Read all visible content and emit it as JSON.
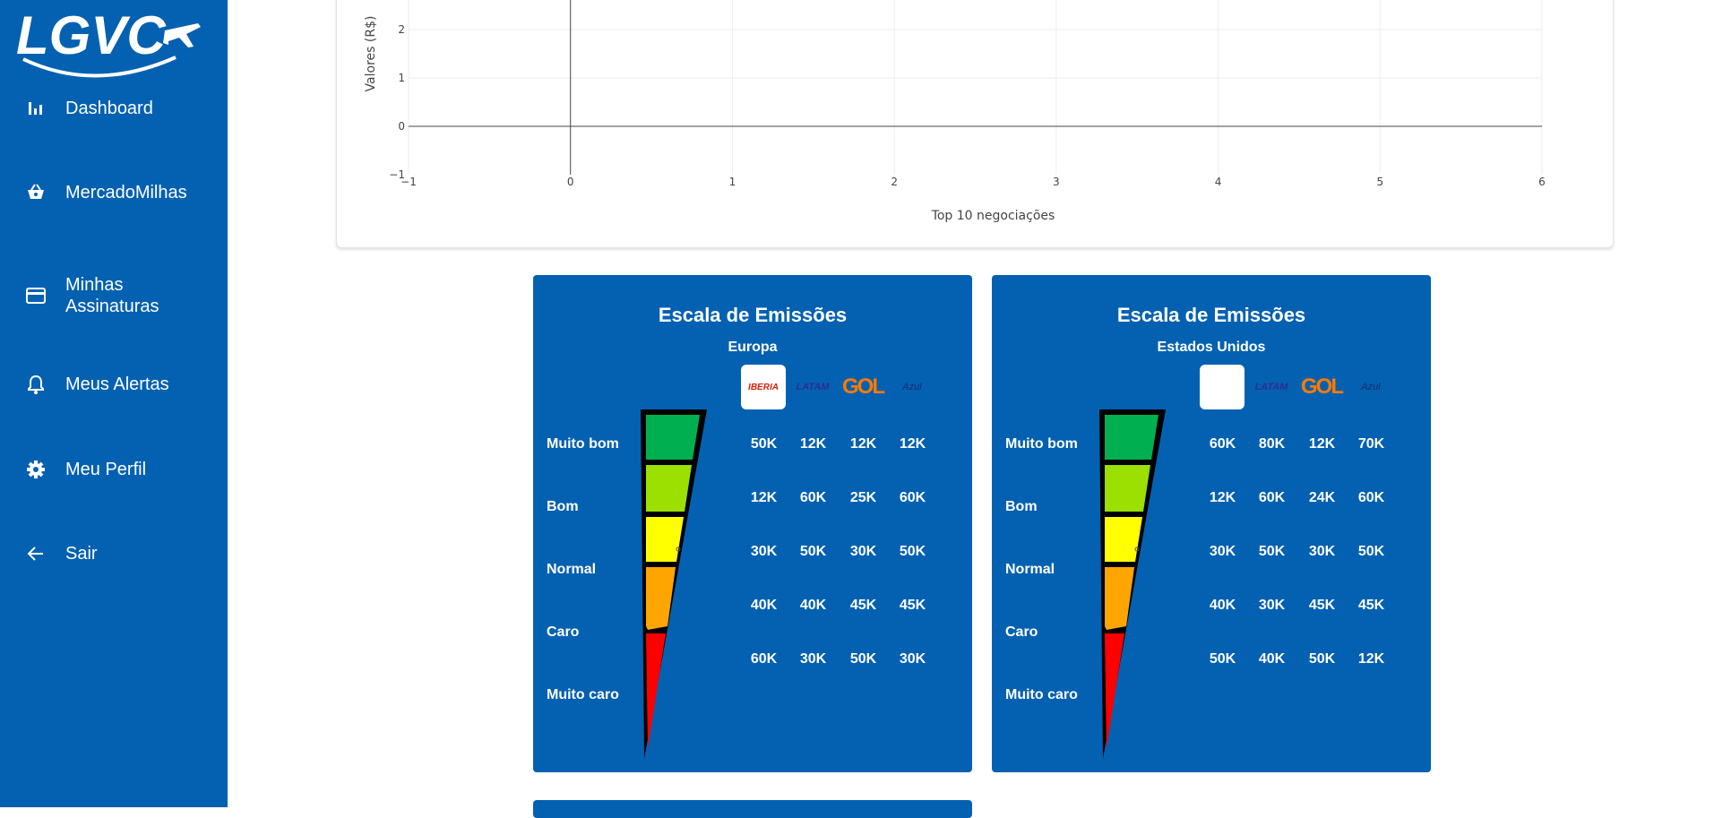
{
  "sidebar": {
    "logo_text": "LGVC",
    "items": [
      {
        "label": "Dashboard",
        "icon": "bar-chart-icon"
      },
      {
        "label": "MercadoMilhas",
        "icon": "shopping-basket-icon"
      },
      {
        "label": "Minhas Assinaturas",
        "icon": "credit-card-icon"
      },
      {
        "label": "Meus Alertas",
        "icon": "bell-icon"
      },
      {
        "label": "Meu Perfil",
        "icon": "gear-icon"
      },
      {
        "label": "Sair",
        "icon": "arrow-left-icon"
      }
    ]
  },
  "chart_data": {
    "type": "line",
    "title": "",
    "xlabel": "Top 10 negociações",
    "ylabel": "Valores (R$)",
    "xlim": [
      -1,
      6
    ],
    "ylim": [
      -1,
      2.5
    ],
    "x_ticks": [
      "−1",
      "0",
      "1",
      "2",
      "3",
      "4",
      "5",
      "6"
    ],
    "y_ticks": [
      "−1",
      "0",
      "1",
      "2"
    ],
    "grid": true,
    "series": []
  },
  "emissions": [
    {
      "title": "Escala de Emissões",
      "region": "Europa",
      "airlines": [
        "IBERIA",
        "LATAM",
        "GOL",
        "Azul"
      ],
      "levels": [
        "Muito bom",
        "Bom",
        "Normal",
        "Caro",
        "Muito caro"
      ],
      "rows": [
        [
          "50K",
          "12K",
          "12K",
          "12K"
        ],
        [
          "12K",
          "60K",
          "25K",
          "60K"
        ],
        [
          "30K",
          "50K",
          "30K",
          "50K"
        ],
        [
          "40K",
          "40K",
          "45K",
          "45K"
        ],
        [
          "60K",
          "30K",
          "50K",
          "30K"
        ]
      ]
    },
    {
      "title": "Escala de Emissões",
      "region": "Estados Unidos",
      "airlines": [
        "",
        "LATAM",
        "GOL",
        "Azul"
      ],
      "levels": [
        "Muito bom",
        "Bom",
        "Normal",
        "Caro",
        "Muito caro"
      ],
      "rows": [
        [
          "60K",
          "80K",
          "12K",
          "70K"
        ],
        [
          "12K",
          "60K",
          "24K",
          "60K"
        ],
        [
          "30K",
          "50K",
          "30K",
          "50K"
        ],
        [
          "40K",
          "30K",
          "45K",
          "45K"
        ],
        [
          "50K",
          "40K",
          "50K",
          "12K"
        ]
      ]
    }
  ],
  "colors": {
    "brand_blue": "#0461b1",
    "gauge": [
      "#00b050",
      "#9be000",
      "#ffff00",
      "#ffa500",
      "#ff0000"
    ]
  }
}
